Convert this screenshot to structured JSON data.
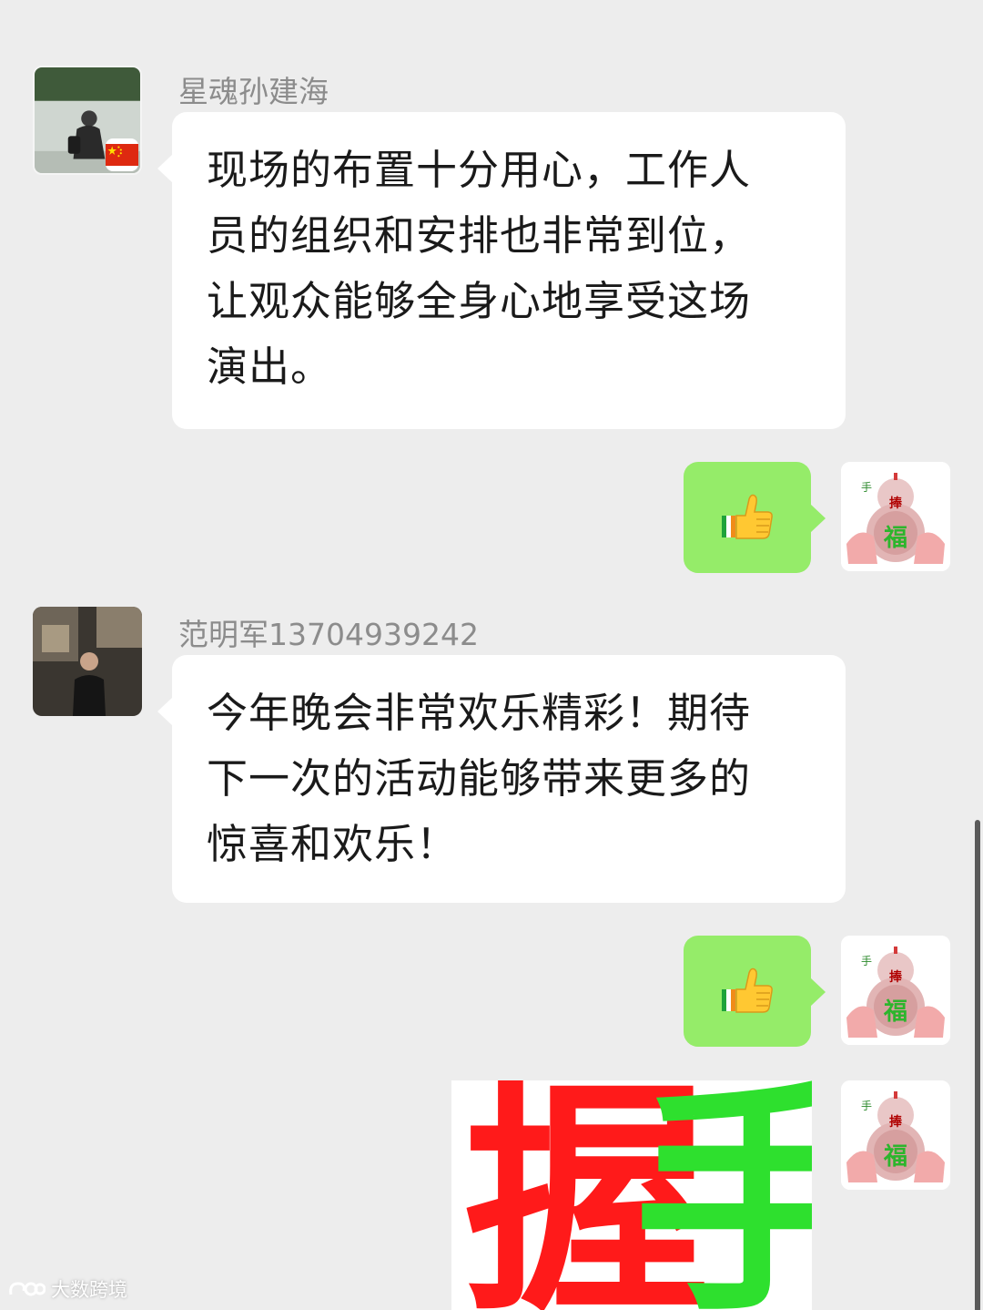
{
  "messages": [
    {
      "sender": "星魂孙建海",
      "side": "left",
      "lines": [
        "现场的布置十分用心，工作人",
        "员的组织和安排也非常到位，",
        "让观众能够全身心地享受这场",
        "演出。"
      ]
    },
    {
      "side": "right",
      "emoji": "thumbs-up"
    },
    {
      "sender": "范明军13704939242",
      "side": "left",
      "lines": [
        "今年晚会非常欢乐精彩！期待",
        "下一次的活动能够带来更多的",
        "惊喜和欢乐！"
      ]
    },
    {
      "side": "right",
      "emoji": "thumbs-up"
    },
    {
      "side": "right",
      "sticker": {
        "chars": [
          "握",
          "手"
        ],
        "colors": [
          "#ff1a1a",
          "#2ee02e"
        ]
      }
    }
  ],
  "self_avatar": {
    "icon": "fortune-gourd-icon",
    "chars": [
      "手",
      "捧",
      "福"
    ]
  },
  "watermark": {
    "text": "大数跨境"
  },
  "colors": {
    "background": "#ededed",
    "incoming_bubble": "#ffffff",
    "outgoing_bubble": "#95ec69",
    "sender_name": "#8c8c8c"
  }
}
